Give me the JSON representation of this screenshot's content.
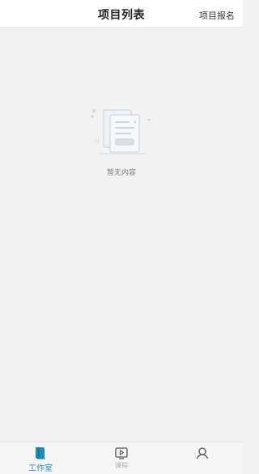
{
  "header": {
    "title": "项目列表",
    "action_label": "项目报名"
  },
  "empty_state": {
    "icon": "empty-document-illustration-icon",
    "message": "暂无内容"
  },
  "tabbar": {
    "tabs": [
      {
        "label": "工作室",
        "icon": "book-icon",
        "active": true
      },
      {
        "label": "课程",
        "icon": "video-play-icon",
        "active": false
      },
      {
        "label": "",
        "icon": "user-profile-icon",
        "active": false
      }
    ]
  },
  "colors": {
    "accent": "#1a8fbf",
    "background": "#f2f2f2",
    "header_bg": "#ffffff"
  }
}
